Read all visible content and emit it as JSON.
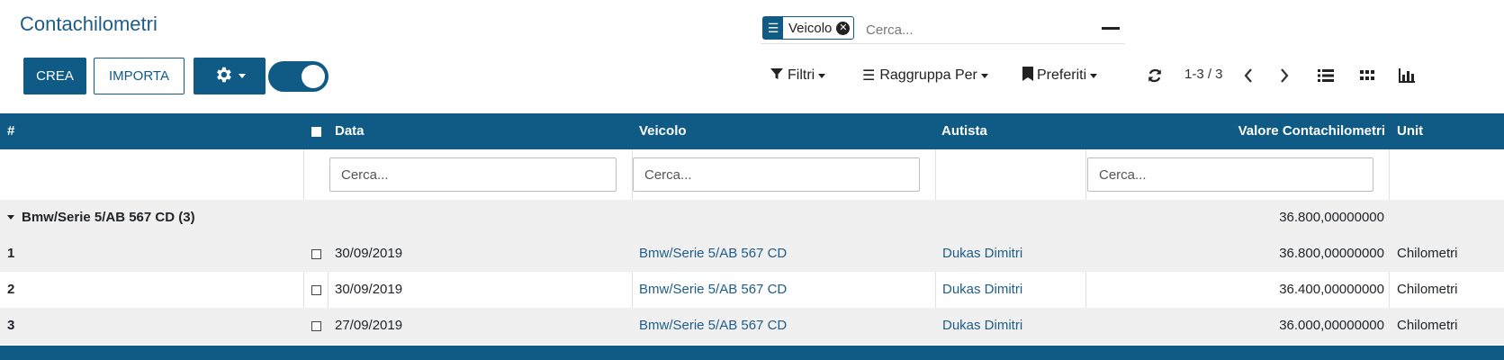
{
  "page": {
    "title": "Contachilometri"
  },
  "buttons": {
    "create": "CREA",
    "import": "IMPORTA"
  },
  "search": {
    "facet_label": "Veicolo",
    "placeholder": "Cerca..."
  },
  "control_panel": {
    "filters": "Filtri",
    "group_by": "Raggruppa Per",
    "favorites": "Preferiti",
    "pager": "1-3 / 3"
  },
  "table": {
    "columns": {
      "num": "#",
      "date": "Data",
      "vehicle": "Veicolo",
      "driver": "Autista",
      "value": "Valore Contachilometri",
      "unit": "Unit"
    },
    "filter_placeholder": "Cerca...",
    "group": {
      "label": "Bmw/Serie 5/AB 567 CD (3)",
      "total": "36.800,00000000"
    },
    "rows": [
      {
        "num": "1",
        "date": "30/09/2019",
        "vehicle": "Bmw/Serie 5/AB 567 CD",
        "driver": "Dukas Dimitri",
        "value": "36.800,00000000",
        "unit": "Chilometri"
      },
      {
        "num": "2",
        "date": "30/09/2019",
        "vehicle": "Bmw/Serie 5/AB 567 CD",
        "driver": "Dukas Dimitri",
        "value": "36.400,00000000",
        "unit": "Chilometri"
      },
      {
        "num": "3",
        "date": "27/09/2019",
        "vehicle": "Bmw/Serie 5/AB 567 CD",
        "driver": "Dukas Dimitri",
        "value": "36.000,00000000",
        "unit": "Chilometri"
      }
    ]
  },
  "icons": {
    "facet": "list-icon",
    "facet_remove": "close-circle-icon",
    "settings": "gear-icon",
    "filters": "filter-icon",
    "group_by": "bars-icon",
    "favorites": "bookmark-icon",
    "refresh": "refresh-icon",
    "prev": "chevron-left-icon",
    "next": "chevron-right-icon",
    "list_view": "list-view-icon",
    "kanban_view": "grid-icon",
    "graph_view": "bar-chart-icon"
  },
  "colors": {
    "primary": "#0f5b86",
    "link": "#1f5c87",
    "group_bg": "#f0f0f0"
  }
}
